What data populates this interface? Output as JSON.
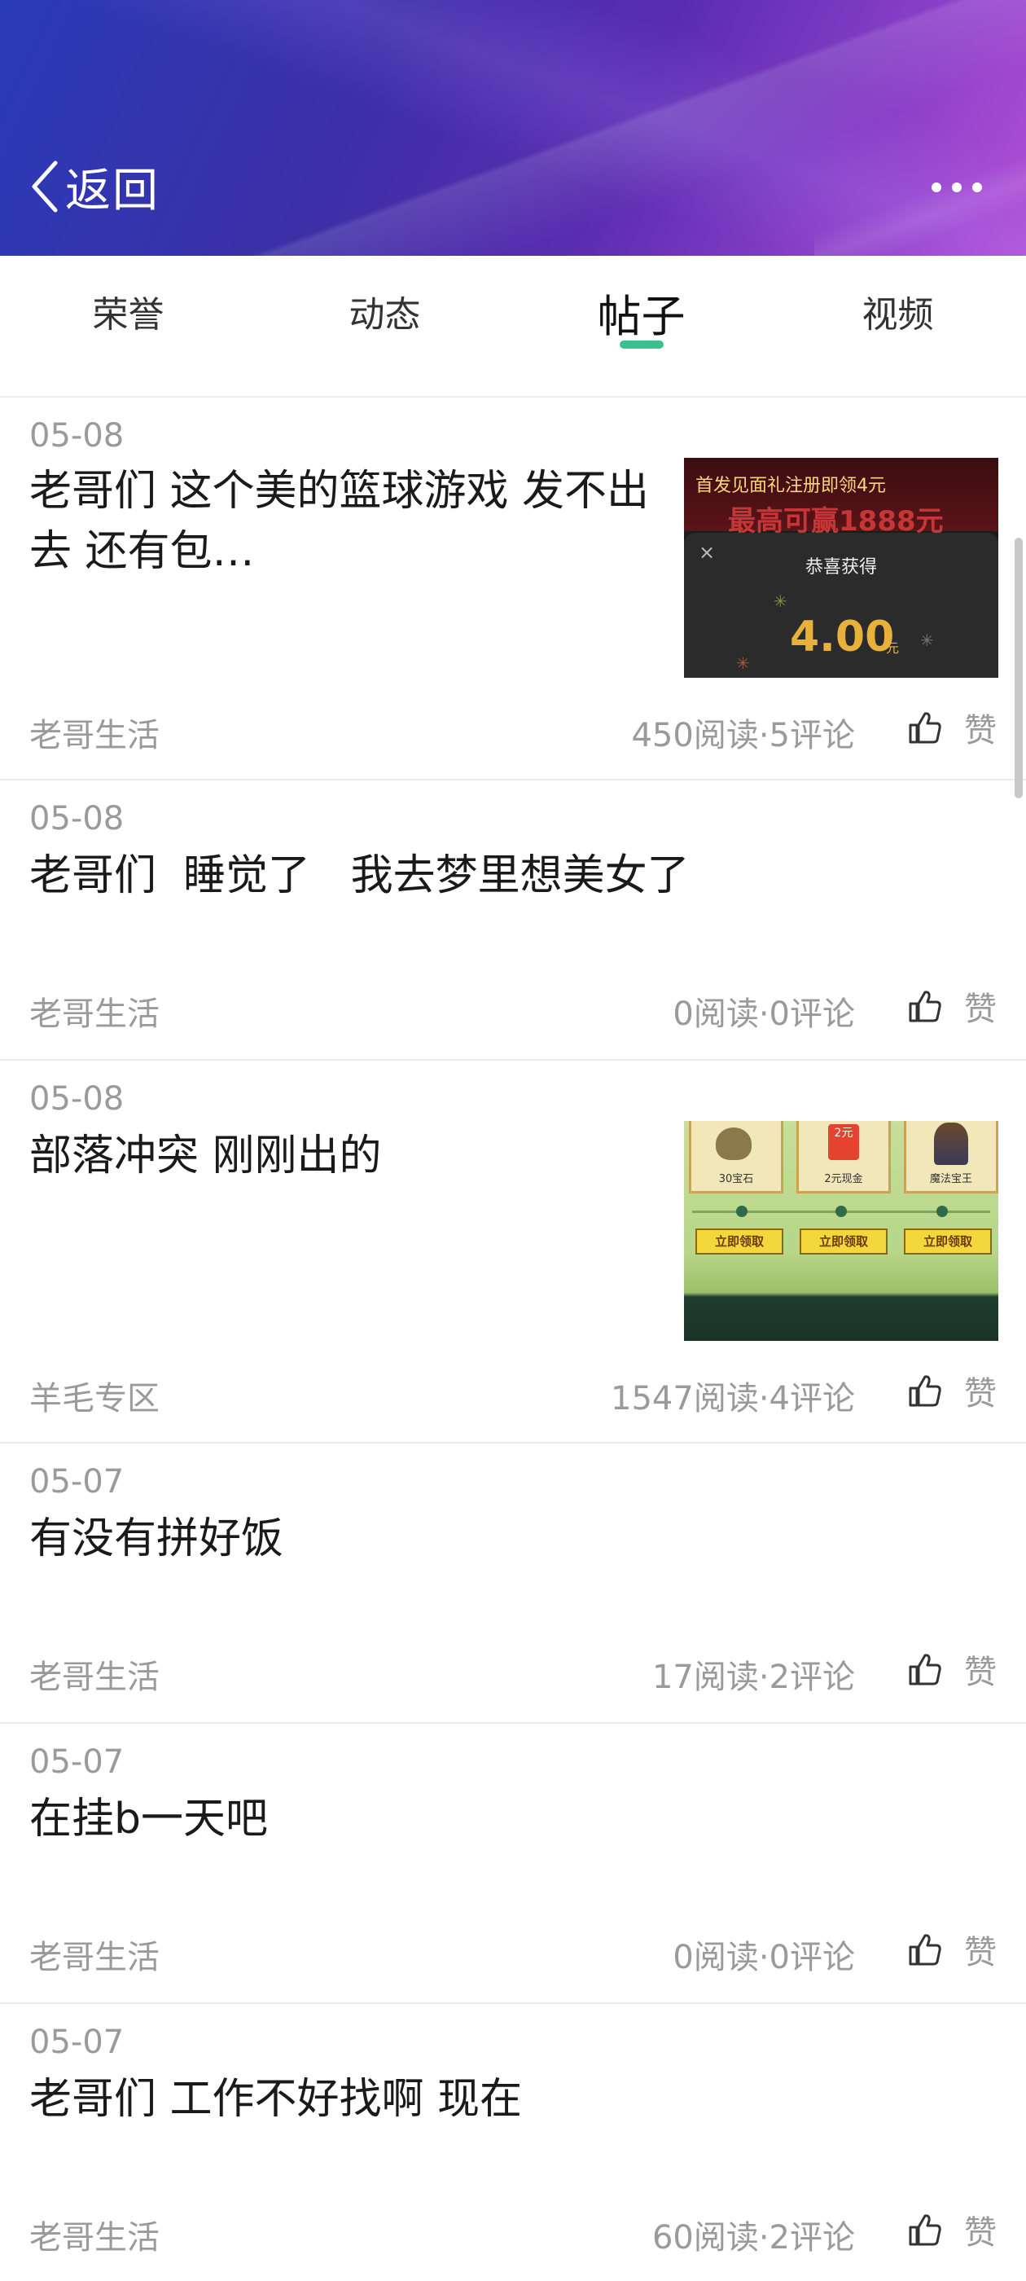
{
  "header": {
    "back_label": "返回"
  },
  "tabs": [
    {
      "label": "荣誉",
      "active": false
    },
    {
      "label": "动态",
      "active": false
    },
    {
      "label": "帖子",
      "active": true
    },
    {
      "label": "视频",
      "active": false
    }
  ],
  "accent_color": "#3bc08f",
  "like_label": "赞",
  "posts": [
    {
      "date": "05-08",
      "title": "老哥们 这个美的篮球游戏 发不出去 还有包…",
      "category": "老哥生活",
      "stats": "450阅读·5评论",
      "thumbnail": {
        "banner": "首发见面礼注册即领4元",
        "banner2": "最高可赢1888元",
        "dialog_title": "恭喜获得",
        "amount": "4.00",
        "unit": "元"
      }
    },
    {
      "date": "05-08",
      "title": "老哥们  睡觉了   我去梦里想美女了",
      "category": "老哥生活",
      "stats": "0阅读·0评论"
    },
    {
      "date": "05-08",
      "title": "部落冲突 刚刚出的",
      "category": "羊毛专区",
      "stats": "1547阅读·4评论",
      "thumbnail": {
        "items": [
          "30宝石",
          "2元现金",
          "魔法宝王"
        ],
        "buttons": [
          "立即领取",
          "立即领取",
          "立即领取"
        ],
        "price_tag": "2元"
      }
    },
    {
      "date": "05-07",
      "title": "有没有拼好饭",
      "category": "老哥生活",
      "stats": "17阅读·2评论"
    },
    {
      "date": "05-07",
      "title": "在挂b一天吧",
      "category": "老哥生活",
      "stats": "0阅读·0评论"
    },
    {
      "date": "05-07",
      "title": "老哥们 工作不好找啊 现在",
      "category": "老哥生活",
      "stats": "60阅读·2评论"
    }
  ]
}
